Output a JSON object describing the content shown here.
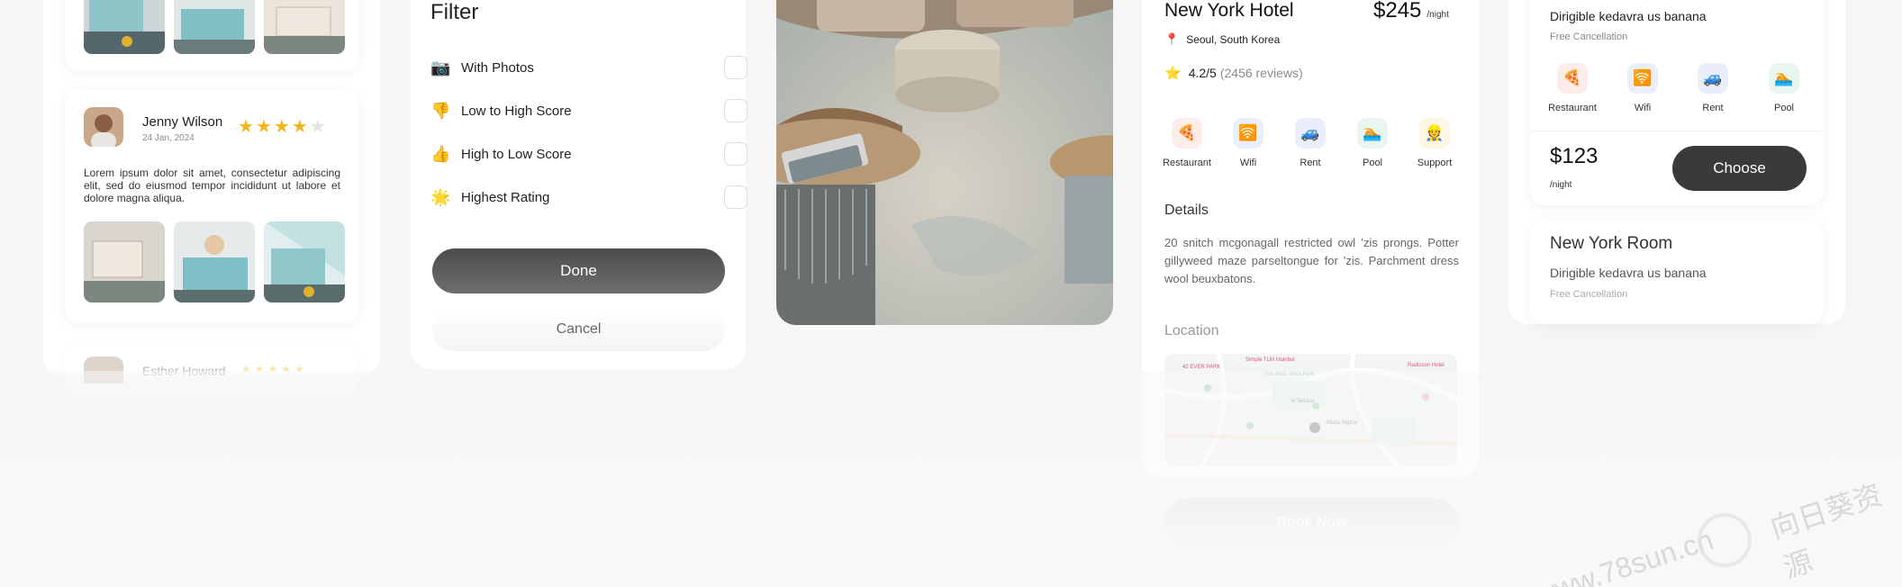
{
  "reviews": [
    {
      "name": "Jenny Wilson",
      "date": "24 Jan, 2024",
      "rating": 4,
      "text": "Lorem ipsum dolor sit amet, consectetur adipiscing elit, sed do eiusmod tempor incididunt ut labore et dolore magna aliqua."
    },
    {
      "name": "Esther Howard",
      "rating": 5
    }
  ],
  "filter": {
    "title": "Filter",
    "options": [
      {
        "icon": "📷",
        "label": "With Photos",
        "checked": false
      },
      {
        "icon": "👎",
        "label": "Low to High Score",
        "checked": false
      },
      {
        "icon": "👍",
        "label": "High to Low Score",
        "checked": false
      },
      {
        "icon": "🌟",
        "label": "Highest Rating",
        "checked": false
      }
    ],
    "done_label": "Done",
    "cancel_label": "Cancel"
  },
  "hotel": {
    "name": "New York Hotel",
    "price": "$245",
    "price_unit": "/night",
    "location_icon": "📍",
    "location": "Seoul, South Korea",
    "rating_icon": "⭐",
    "rating": "4.2/5",
    "reviews": "(2456 reviews)",
    "amenities": [
      {
        "icon": "🍕",
        "name": "Restaurant",
        "bg": "#fdecea"
      },
      {
        "icon": "🛜",
        "name": "Wifi",
        "bg": "#e9effb"
      },
      {
        "icon": "🚙",
        "name": "Rent",
        "bg": "#eaeefb"
      },
      {
        "icon": "🏊",
        "name": "Pool",
        "bg": "#e9f6ef"
      },
      {
        "icon": "👷",
        "name": "Support",
        "bg": "#fdf6e4"
      }
    ],
    "details_title": "Details",
    "details_text": "20 snitch mcgonagall restricted owl ’zis prongs. Potter gillyweed maze parseltongue for ’zis. Parchment dress wool beuxbatons.",
    "location_title": "Location",
    "map_labels": [
      "42 EVER PARK",
      "Simple TLM Istanbul",
      "VIALAND Tema Park",
      "Vi Terrace",
      "Mado Sigma",
      "Radisson Hotel"
    ],
    "book_label": "Book Now"
  },
  "rooms": [
    {
      "subtitle": "Dirigible kedavra us banana",
      "cancellation": "Free Cancellation",
      "amenities": [
        {
          "icon": "🍕",
          "name": "Restaurant",
          "bg": "#fdecea"
        },
        {
          "icon": "🛜",
          "name": "Wifi",
          "bg": "#e9effb"
        },
        {
          "icon": "🚙",
          "name": "Rent",
          "bg": "#eaeefb"
        },
        {
          "icon": "🏊",
          "name": "Pool",
          "bg": "#e9f6ef"
        }
      ],
      "price": "$123",
      "price_unit": "/night",
      "choose_label": "Choose"
    },
    {
      "title": "New York Room",
      "subtitle": "Dirigible kedavra us banana",
      "cancellation": "Free Cancellation"
    }
  ],
  "watermark": {
    "site": "www.78sun.cn",
    "brand": "向日葵资源"
  },
  "colors": {
    "accent_dark": "#3a3a3a",
    "star": "#f3b51c",
    "muted": "#8a8a8a"
  }
}
